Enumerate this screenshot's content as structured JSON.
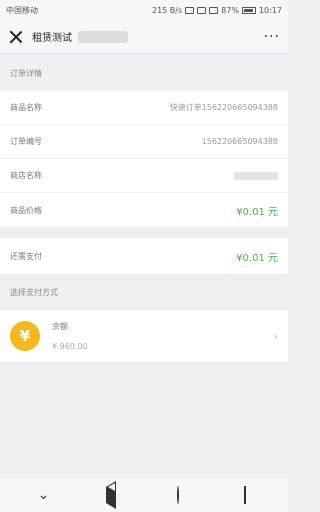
{
  "status_bar": {
    "carrier": "中国移动",
    "net_speed": "215 B/s",
    "battery": "87%",
    "time": "10:17"
  },
  "header": {
    "title": "租赁测试"
  },
  "order_section": {
    "title": "订单详情",
    "rows": [
      {
        "label": "商品名称",
        "value": "快速订单156220665094388"
      },
      {
        "label": "订单编号",
        "value": "156220665094388"
      },
      {
        "label": "商店名称",
        "value": ""
      },
      {
        "label": "商品价格",
        "value": "¥0.01 元"
      }
    ]
  },
  "due": {
    "label": "还需支付",
    "value": "¥0.01 元"
  },
  "payment_section": {
    "title": "选择支付方式",
    "method": {
      "name": "余额",
      "balance": "¥ 960.00",
      "icon_glyph": "¥"
    }
  },
  "colors": {
    "accent_green": "#4caf50",
    "coin_gold": "#f5b81e"
  }
}
